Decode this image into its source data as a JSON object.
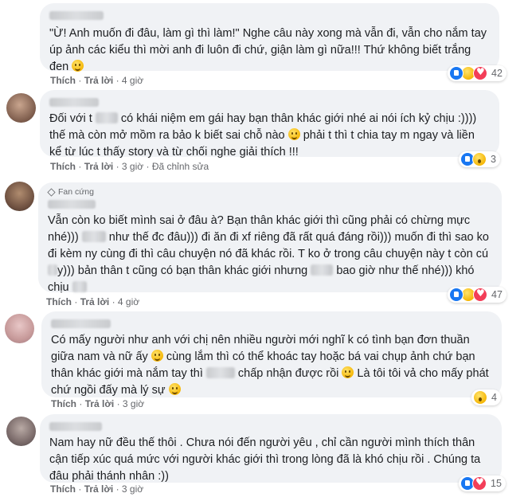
{
  "actions": {
    "like": "Thích",
    "reply": "Trả lời",
    "sep": "·"
  },
  "comments": [
    {
      "text_parts": [
        "\"Ừ! Anh muốn đi đâu, làm gì thì làm!\" Nghe câu này xong mà vẫn đi, vẫn cho nắm tay úp ảnh các kiểu thì mời anh đi luôn đi chứ, giận làm gì nữa!!! Thứ không biết trắng đen"
      ],
      "time": "4 giờ",
      "edited": "",
      "reaction_count": "42",
      "reactions": [
        "like-icon",
        "haha-icon",
        "love-icon"
      ]
    },
    {
      "text_parts": [
        "Đối với t",
        "có khái niệm em gái hay bạn thân khác giới nhé ai nói ích kỷ chịu :)))) thế mà còn mở mồm ra bảo k biết sai chỗ nào",
        "phải t thì t chia tay m ngay và liền kể từ lúc t thấy story và từ chối nghe giải thích !!!"
      ],
      "time": "3 giờ",
      "edited": "Đã chỉnh sửa",
      "reaction_count": "3",
      "reactions": [
        "like-icon",
        "wow-icon"
      ]
    },
    {
      "badge": "Fan cứng",
      "text_parts": [
        "Vẫn còn ko biết mình sai ở đâu à? Bạn thân khác giới thì cũng phải có chừng mực nhé))) ",
        "như thế đc đâu))) đi ăn đi xf riêng đã rất quá đáng rồi))) muốn đi thì sao ko đi kèm ny cùng đi thì câu chuyện nó đã khác rồi. T ko ở trong câu chuyện này t còn cú",
        "y))) bản thân t cũng có bạn thân khác giới nhưng",
        "bao giờ như thế nhé))) khó chịu"
      ],
      "time": "4 giờ",
      "edited": "",
      "reaction_count": "47",
      "reactions": [
        "like-icon",
        "haha-icon",
        "love-icon"
      ]
    },
    {
      "text_parts": [
        "Có mấy người như anh với chị nên nhiều người mới nghĩ k có tình bạn đơn thuần giữa nam và nữ ấy",
        "cùng lắm thì có thể khoác tay hoặc bá vai chụp ảnh chứ bạn thân khác giới mà nắm tay thì",
        "chấp nhận được rồi",
        "Là tôi tôi vả cho mấy phát chứ ngồi đấy mà lý sự"
      ],
      "time": "3 giờ",
      "edited": "",
      "reaction_count": "4",
      "reactions": [
        "wow-icon"
      ]
    },
    {
      "text_parts": [
        "Nam hay nữ đều thế thôi . Chưa nói đến người yêu , chỉ cần người mình thích thân cận tiếp xúc quá mức với người khác giới thì trong lòng đã là khó chịu rồi . Chúng ta đâu phải thánh nhân :))"
      ],
      "time": "3 giờ",
      "edited": "",
      "reaction_count": "15",
      "reactions": [
        "like-icon",
        "love-icon"
      ]
    }
  ]
}
